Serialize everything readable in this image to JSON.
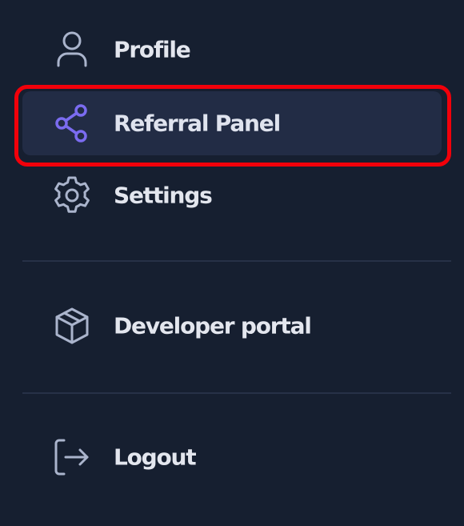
{
  "menu": {
    "items": [
      {
        "label": "Profile",
        "icon": "user-icon"
      },
      {
        "label": "Referral Panel",
        "icon": "share-icon",
        "active": true
      },
      {
        "label": "Settings",
        "icon": "gear-icon"
      },
      {
        "label": "Developer portal",
        "icon": "box-icon"
      },
      {
        "label": "Logout",
        "icon": "logout-icon"
      }
    ]
  },
  "colors": {
    "background": "#161f30",
    "active_background": "#222c45",
    "icon": "#aab4cc",
    "active_icon": "#7b6cf0",
    "highlight": "#f2000a",
    "divider": "#273147"
  }
}
